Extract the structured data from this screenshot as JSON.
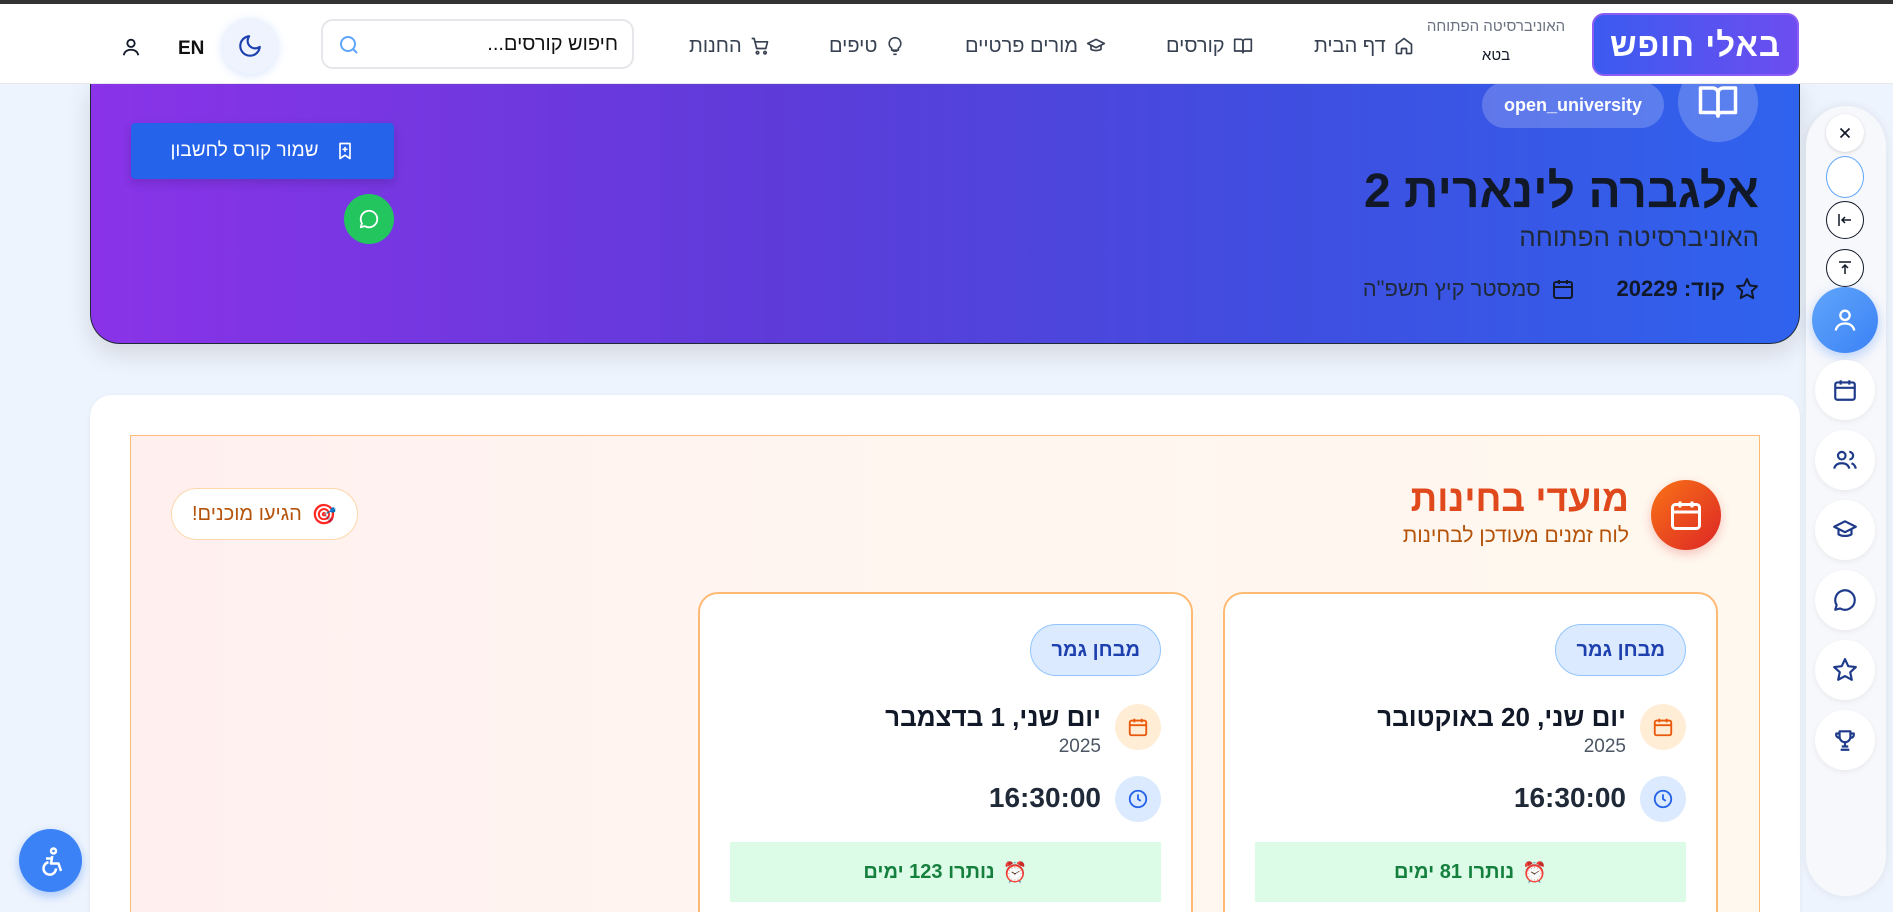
{
  "header": {
    "brand": "באלי חופש",
    "university_name": "האוניברסיטה הפתוחה",
    "beta_label": "בטא",
    "nav": [
      {
        "label": "דף הבית",
        "icon": "home-icon"
      },
      {
        "label": "קורסים",
        "icon": "book-icon"
      },
      {
        "label": "מורים פרטיים",
        "icon": "graduation-cap-icon"
      },
      {
        "label": "טיפים",
        "icon": "lightbulb-icon"
      },
      {
        "label": "החנות",
        "icon": "cart-icon"
      }
    ],
    "search_placeholder": "חיפוש קורסים...",
    "language": "EN",
    "theme_icon": "moon-icon",
    "user_icon": "user-icon"
  },
  "course": {
    "tag": "open_university",
    "title": "אלגברה לינארית 2",
    "university": "האוניברסיטה הפתוחה",
    "code_label": "קוד: 20229",
    "semester": "סמסטר קיץ תשפ\"ה",
    "save_label": "שמור קורס לחשבון"
  },
  "exams": {
    "title": "מועדי בחינות",
    "subtitle": "לוח זמנים מעודכן לבחינות",
    "ready_label": "הגיעו מוכנים!",
    "ready_emoji": "🎯",
    "alarm_emoji": "⏰",
    "items": [
      {
        "type": "מבחן גמר",
        "date": "יום שני, 20 באוקטובר",
        "year": "2025",
        "time": "16:30:00",
        "remaining": "נותרו 81 ימים"
      },
      {
        "type": "מבחן גמר",
        "date": "יום שני, 1 בדצמבר",
        "year": "2025",
        "time": "16:30:00",
        "remaining": "נותרו 123 ימים"
      }
    ]
  },
  "colors": {
    "brand_blue": "#3b5bf0",
    "hero_start": "#8a33e8",
    "hero_end": "#2f63ee",
    "exam_title": "#e0491c",
    "remaining_green": "#15803d",
    "chat_green": "#22c55e"
  },
  "rail_icons": [
    "close-icon",
    "collapse-icon",
    "scroll-top-icon",
    "user-icon",
    "calendar-icon",
    "users-icon",
    "graduation-cap-icon",
    "chat-icon",
    "star-icon",
    "trophy-icon"
  ]
}
